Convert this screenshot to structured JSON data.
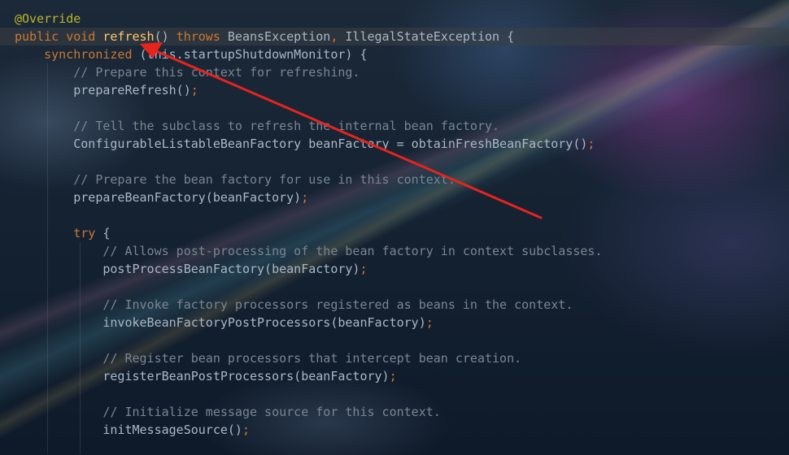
{
  "colors": {
    "keyword": "#cc7832",
    "method_name": "#ffc66d",
    "annotation": "#bbb529",
    "comment": "#7a8590",
    "text": "#a9b7c6",
    "arrow": "#e8231e"
  },
  "code": {
    "l1": {
      "annotation": "@Override"
    },
    "l2": {
      "kw_public": "public",
      "kw_void": "void",
      "method": "refresh",
      "parens": "()",
      "kw_throws": "throws",
      "ex1": "BeansException",
      "comma": ",",
      "ex2": "IllegalStateException",
      "brace": "{"
    },
    "l3": {
      "kw_sync": "synchronized",
      "text": " (this.startupShutdownMonitor) {"
    },
    "l4": {
      "comment": "// Prepare this context for refreshing."
    },
    "l5": {
      "call": "prepareRefresh()",
      "semi": ";"
    },
    "l7": {
      "comment": "// Tell the subclass to refresh the internal bean factory."
    },
    "l8": {
      "call": "ConfigurableListableBeanFactory beanFactory = obtainFreshBeanFactory()",
      "semi": ";"
    },
    "l10": {
      "comment": "// Prepare the bean factory for use in this context."
    },
    "l11": {
      "call": "prepareBeanFactory(beanFactory)",
      "semi": ";"
    },
    "l13": {
      "kw_try": "try",
      "brace": " {"
    },
    "l14": {
      "comment": "// Allows post-processing of the bean factory in context subclasses."
    },
    "l15": {
      "call": "postProcessBeanFactory(beanFactory)",
      "semi": ";"
    },
    "l17": {
      "comment": "// Invoke factory processors registered as beans in the context."
    },
    "l18": {
      "call": "invokeBeanFactoryPostProcessors(beanFactory)",
      "semi": ";"
    },
    "l20": {
      "comment": "// Register bean processors that intercept bean creation."
    },
    "l21": {
      "call": "registerBeanPostProcessors(beanFactory)",
      "semi": ";"
    },
    "l23": {
      "comment": "// Initialize message source for this context."
    },
    "l24": {
      "call": "initMessageSource()",
      "semi": ";"
    }
  }
}
